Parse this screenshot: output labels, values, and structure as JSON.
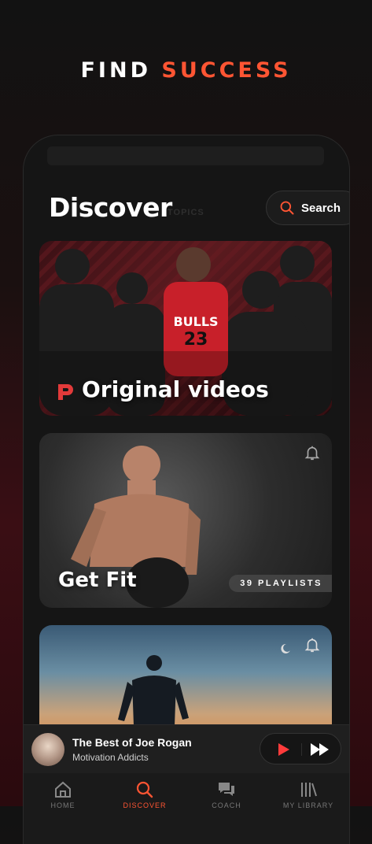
{
  "headline": {
    "word1": "FIND",
    "word2": "SUCCESS"
  },
  "header": {
    "title": "Discover",
    "ghost_text": "TOPICS",
    "search_label": "Search"
  },
  "cards": [
    {
      "title": "Original videos"
    },
    {
      "title": "Get Fit",
      "badge": "39 PLAYLISTS"
    },
    {
      "title": ""
    }
  ],
  "now_playing": {
    "title": "The Best of Joe Rogan",
    "subtitle": "Motivation Addicts"
  },
  "tabs": [
    {
      "label": "HOME",
      "icon": "home-icon"
    },
    {
      "label": "DISCOVER",
      "icon": "search-icon",
      "active": true
    },
    {
      "label": "COACH",
      "icon": "chat-icon"
    },
    {
      "label": "MY LIBRARY",
      "icon": "library-icon"
    }
  ],
  "colors": {
    "accent": "#ff5533",
    "background": "#151515"
  }
}
